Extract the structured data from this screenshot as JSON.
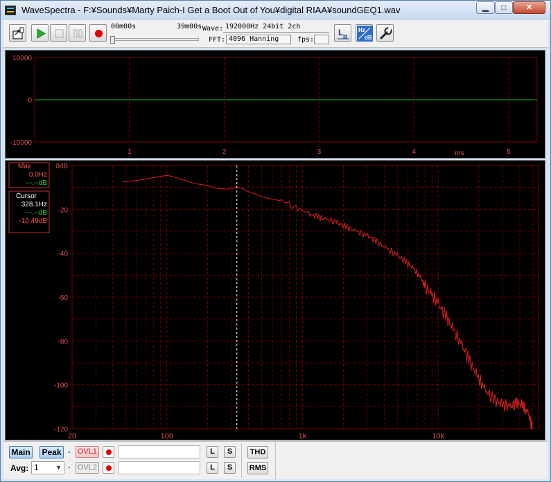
{
  "window": {
    "title": "WaveSpectra - F:¥Sounds¥Marty Paich-I Get a Boot Out of You¥digital RIAA¥soundGEQ1.wav",
    "min_label": "▁",
    "max_label": "□",
    "close_label": "✕"
  },
  "toolbar": {
    "time_start": "00m00s",
    "time_end": "39m00s",
    "seek_position": 0.0,
    "wave_label": "Wave:",
    "wave_value": "192000Hz 24bit 2ch",
    "fft_label": "FFT:",
    "fft_value": "4096 Hanning",
    "fps_label": "fps:",
    "fps_value": ""
  },
  "wave_panel": {
    "y_ticks": [
      "10000",
      "0",
      "-10000"
    ],
    "x_ticks": [
      "1",
      "2",
      "3",
      "4",
      "5"
    ],
    "x_unit": "ms"
  },
  "spectrum_panel": {
    "max_box": {
      "title": "Max",
      "freq": "0.0Hz",
      "level": "---.--dB"
    },
    "cursor_box": {
      "title": "Cursor",
      "freq": "328.1Hz",
      "level_l": "---.--dB",
      "level_r": "-10.49dB"
    }
  },
  "bottom": {
    "main_label": "Main",
    "peak_label": "Peak",
    "dash": "-",
    "ovl1_label": "OVL1",
    "ovl2_label": "OVL2",
    "l_label": "L",
    "s_label": "S",
    "thd_label": "THD",
    "rms_label": "RMS",
    "avg_label": "Avg:",
    "avg_value": "1"
  },
  "colors": {
    "grid": "#800000",
    "axis_text_wave": "#e05050",
    "axis_text_spec": "#e05050",
    "waveform": "#00c000",
    "spectrum": "#d82020",
    "cursor": "#ffffff"
  },
  "chart_data": [
    {
      "type": "line",
      "title": "",
      "xlabel": "ms",
      "ylabel": "",
      "xlim": [
        0,
        5.3
      ],
      "ylim": [
        -10000,
        10000
      ],
      "y_ticks": [
        10000,
        0,
        -10000
      ],
      "x_ticks": [
        1,
        2,
        3,
        4,
        5
      ],
      "grid": true,
      "series": [
        {
          "values": [
            [
              0,
              0
            ],
            [
              5.3,
              0
            ]
          ]
        }
      ]
    },
    {
      "type": "line",
      "title": "",
      "xlabel": "",
      "ylabel": "",
      "x_scale": "log",
      "xlim": [
        20,
        22000
      ],
      "ylim": [
        -120,
        0
      ],
      "x_ticks": [
        "20",
        "100",
        "1k",
        "10k"
      ],
      "y_ticks": [
        "0dB",
        "-20",
        "-40",
        "-60",
        "-80",
        "-100",
        "-120"
      ],
      "grid": true,
      "cursor_freq_hz": 328.1,
      "series": [
        {
          "points": [
            [
              47,
              -7.5
            ],
            [
              60,
              -6.8
            ],
            [
              75,
              -5.8
            ],
            [
              90,
              -5.0
            ],
            [
              100,
              -4.5
            ],
            [
              110,
              -5.0
            ],
            [
              130,
              -6.5
            ],
            [
              160,
              -8.2
            ],
            [
              200,
              -9.2
            ],
            [
              240,
              -10.5
            ],
            [
              280,
              -10.8
            ],
            [
              320,
              -10.2
            ],
            [
              330,
              -9.8
            ],
            [
              360,
              -10.5
            ],
            [
              400,
              -12.0
            ],
            [
              450,
              -13.0
            ],
            [
              500,
              -14.2
            ],
            [
              560,
              -15.0
            ],
            [
              620,
              -15.5
            ],
            [
              700,
              -16.2
            ],
            [
              780,
              -17.5
            ],
            [
              850,
              -18.8
            ],
            [
              950,
              -20.0
            ],
            [
              1100,
              -22.0
            ],
            [
              1300,
              -23.5
            ],
            [
              1500,
              -24.5
            ],
            [
              1800,
              -26.0
            ],
            [
              2100,
              -28.0
            ],
            [
              2500,
              -30.0
            ],
            [
              3000,
              -32.0
            ],
            [
              3500,
              -34.5
            ],
            [
              4200,
              -38.0
            ],
            [
              5000,
              -41.0
            ],
            [
              5800,
              -44.0
            ],
            [
              6600,
              -47.0
            ],
            [
              7400,
              -51.0
            ],
            [
              8000,
              -55.0
            ],
            [
              9000,
              -59.0
            ],
            [
              10000,
              -63.0
            ],
            [
              11500,
              -69.0
            ],
            [
              13000,
              -75.0
            ],
            [
              15000,
              -82.0
            ],
            [
              17000,
              -89.0
            ],
            [
              19500,
              -96.0
            ],
            [
              22000,
              -102.0
            ],
            [
              26000,
              -107.0
            ],
            [
              30000,
              -109.0
            ],
            [
              34000,
              -110.0
            ],
            [
              38000,
              -108.5
            ],
            [
              42000,
              -109.0
            ],
            [
              46000,
              -113.0
            ],
            [
              50000,
              -120.0
            ]
          ]
        }
      ]
    }
  ]
}
